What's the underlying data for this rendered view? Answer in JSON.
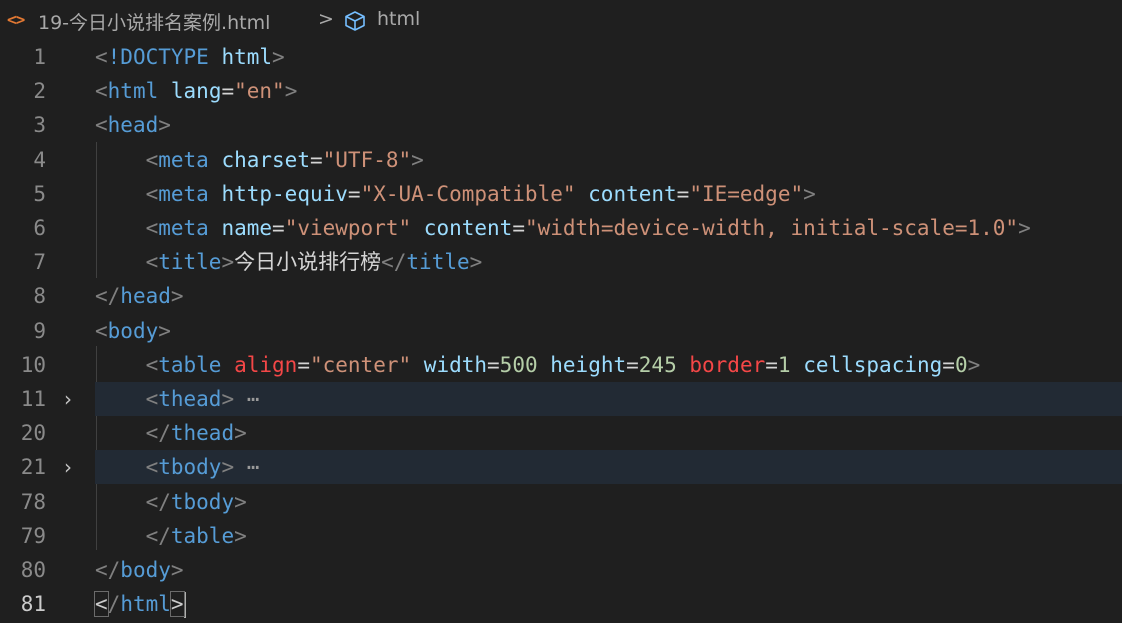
{
  "breadcrumb": {
    "file_icon": "html-file-icon",
    "file": "19-今日小说排名案例.html",
    "separator": ">",
    "node_icon": "cube-icon",
    "node": "html"
  },
  "lines": [
    {
      "num": "1",
      "tokens": [
        [
          "b",
          "<"
        ],
        [
          "t",
          "!DOCTYPE"
        ],
        [
          "p",
          " "
        ],
        [
          "a",
          "html"
        ],
        [
          "b",
          ">"
        ]
      ]
    },
    {
      "num": "2",
      "tokens": [
        [
          "b",
          "<"
        ],
        [
          "t",
          "html"
        ],
        [
          "p",
          " "
        ],
        [
          "a",
          "lang"
        ],
        [
          "p",
          "="
        ],
        [
          "s",
          "\"en\""
        ],
        [
          "b",
          ">"
        ]
      ]
    },
    {
      "num": "3",
      "tokens": [
        [
          "b",
          "<"
        ],
        [
          "t",
          "head"
        ],
        [
          "b",
          ">"
        ]
      ]
    },
    {
      "num": "4",
      "tokens": [
        [
          "p",
          "    "
        ],
        [
          "b",
          "<"
        ],
        [
          "t",
          "meta"
        ],
        [
          "p",
          " "
        ],
        [
          "a",
          "charset"
        ],
        [
          "p",
          "="
        ],
        [
          "s",
          "\"UTF-8\""
        ],
        [
          "b",
          ">"
        ]
      ]
    },
    {
      "num": "5",
      "tokens": [
        [
          "p",
          "    "
        ],
        [
          "b",
          "<"
        ],
        [
          "t",
          "meta"
        ],
        [
          "p",
          " "
        ],
        [
          "a",
          "http-equiv"
        ],
        [
          "p",
          "="
        ],
        [
          "s",
          "\"X-UA-Compatible\""
        ],
        [
          "p",
          " "
        ],
        [
          "a",
          "content"
        ],
        [
          "p",
          "="
        ],
        [
          "s",
          "\"IE=edge\""
        ],
        [
          "b",
          ">"
        ]
      ]
    },
    {
      "num": "6",
      "tokens": [
        [
          "p",
          "    "
        ],
        [
          "b",
          "<"
        ],
        [
          "t",
          "meta"
        ],
        [
          "p",
          " "
        ],
        [
          "a",
          "name"
        ],
        [
          "p",
          "="
        ],
        [
          "s",
          "\"viewport\""
        ],
        [
          "p",
          " "
        ],
        [
          "a",
          "content"
        ],
        [
          "p",
          "="
        ],
        [
          "s",
          "\"width=device-width, initial-scale=1.0\""
        ],
        [
          "b",
          ">"
        ]
      ]
    },
    {
      "num": "7",
      "tokens": [
        [
          "p",
          "    "
        ],
        [
          "b",
          "<"
        ],
        [
          "t",
          "title"
        ],
        [
          "b",
          ">"
        ],
        [
          "p",
          "今日小说排行榜"
        ],
        [
          "b",
          "</"
        ],
        [
          "t",
          "title"
        ],
        [
          "b",
          ">"
        ]
      ]
    },
    {
      "num": "8",
      "tokens": [
        [
          "b",
          "</"
        ],
        [
          "t",
          "head"
        ],
        [
          "b",
          ">"
        ]
      ]
    },
    {
      "num": "9",
      "tokens": [
        [
          "b",
          "<"
        ],
        [
          "t",
          "body"
        ],
        [
          "b",
          ">"
        ]
      ]
    },
    {
      "num": "10",
      "tokens": [
        [
          "p",
          "    "
        ],
        [
          "b",
          "<"
        ],
        [
          "t",
          "table"
        ],
        [
          "p",
          " "
        ],
        [
          "ar",
          "align"
        ],
        [
          "p",
          "="
        ],
        [
          "s",
          "\"center\""
        ],
        [
          "p",
          " "
        ],
        [
          "a",
          "width"
        ],
        [
          "p",
          "="
        ],
        [
          "n",
          "500"
        ],
        [
          "p",
          " "
        ],
        [
          "a",
          "height"
        ],
        [
          "p",
          "="
        ],
        [
          "n",
          "245"
        ],
        [
          "p",
          " "
        ],
        [
          "ar",
          "border"
        ],
        [
          "p",
          "="
        ],
        [
          "n",
          "1"
        ],
        [
          "p",
          " "
        ],
        [
          "a",
          "cellspacing"
        ],
        [
          "p",
          "="
        ],
        [
          "n",
          "0"
        ],
        [
          "b",
          ">"
        ]
      ]
    },
    {
      "num": "11",
      "fold": "›",
      "highlight": true,
      "tokens": [
        [
          "p",
          "    "
        ],
        [
          "b",
          "<"
        ],
        [
          "t",
          "thead"
        ],
        [
          "b",
          ">"
        ],
        [
          "ell",
          " ⋯"
        ]
      ]
    },
    {
      "num": "20",
      "tokens": [
        [
          "p",
          "    "
        ],
        [
          "b",
          "</"
        ],
        [
          "t",
          "thead"
        ],
        [
          "b",
          ">"
        ]
      ]
    },
    {
      "num": "21",
      "fold": "›",
      "highlight": true,
      "tokens": [
        [
          "p",
          "    "
        ],
        [
          "b",
          "<"
        ],
        [
          "t",
          "tbody"
        ],
        [
          "b",
          ">"
        ],
        [
          "ell",
          " ⋯"
        ]
      ]
    },
    {
      "num": "78",
      "tokens": [
        [
          "p",
          "    "
        ],
        [
          "b",
          "</"
        ],
        [
          "t",
          "tbody"
        ],
        [
          "b",
          ">"
        ]
      ]
    },
    {
      "num": "79",
      "tokens": [
        [
          "p",
          "    "
        ],
        [
          "b",
          "</"
        ],
        [
          "t",
          "table"
        ],
        [
          "b",
          ">"
        ]
      ]
    },
    {
      "num": "80",
      "tokens": [
        [
          "b",
          "</"
        ],
        [
          "t",
          "body"
        ],
        [
          "b",
          ">"
        ]
      ]
    },
    {
      "num": "81",
      "active": true,
      "cursor": true,
      "tokens": [
        [
          "bm",
          "<"
        ],
        [
          "b",
          "/"
        ],
        [
          "t",
          "html"
        ],
        [
          "bm",
          ">"
        ]
      ]
    }
  ]
}
